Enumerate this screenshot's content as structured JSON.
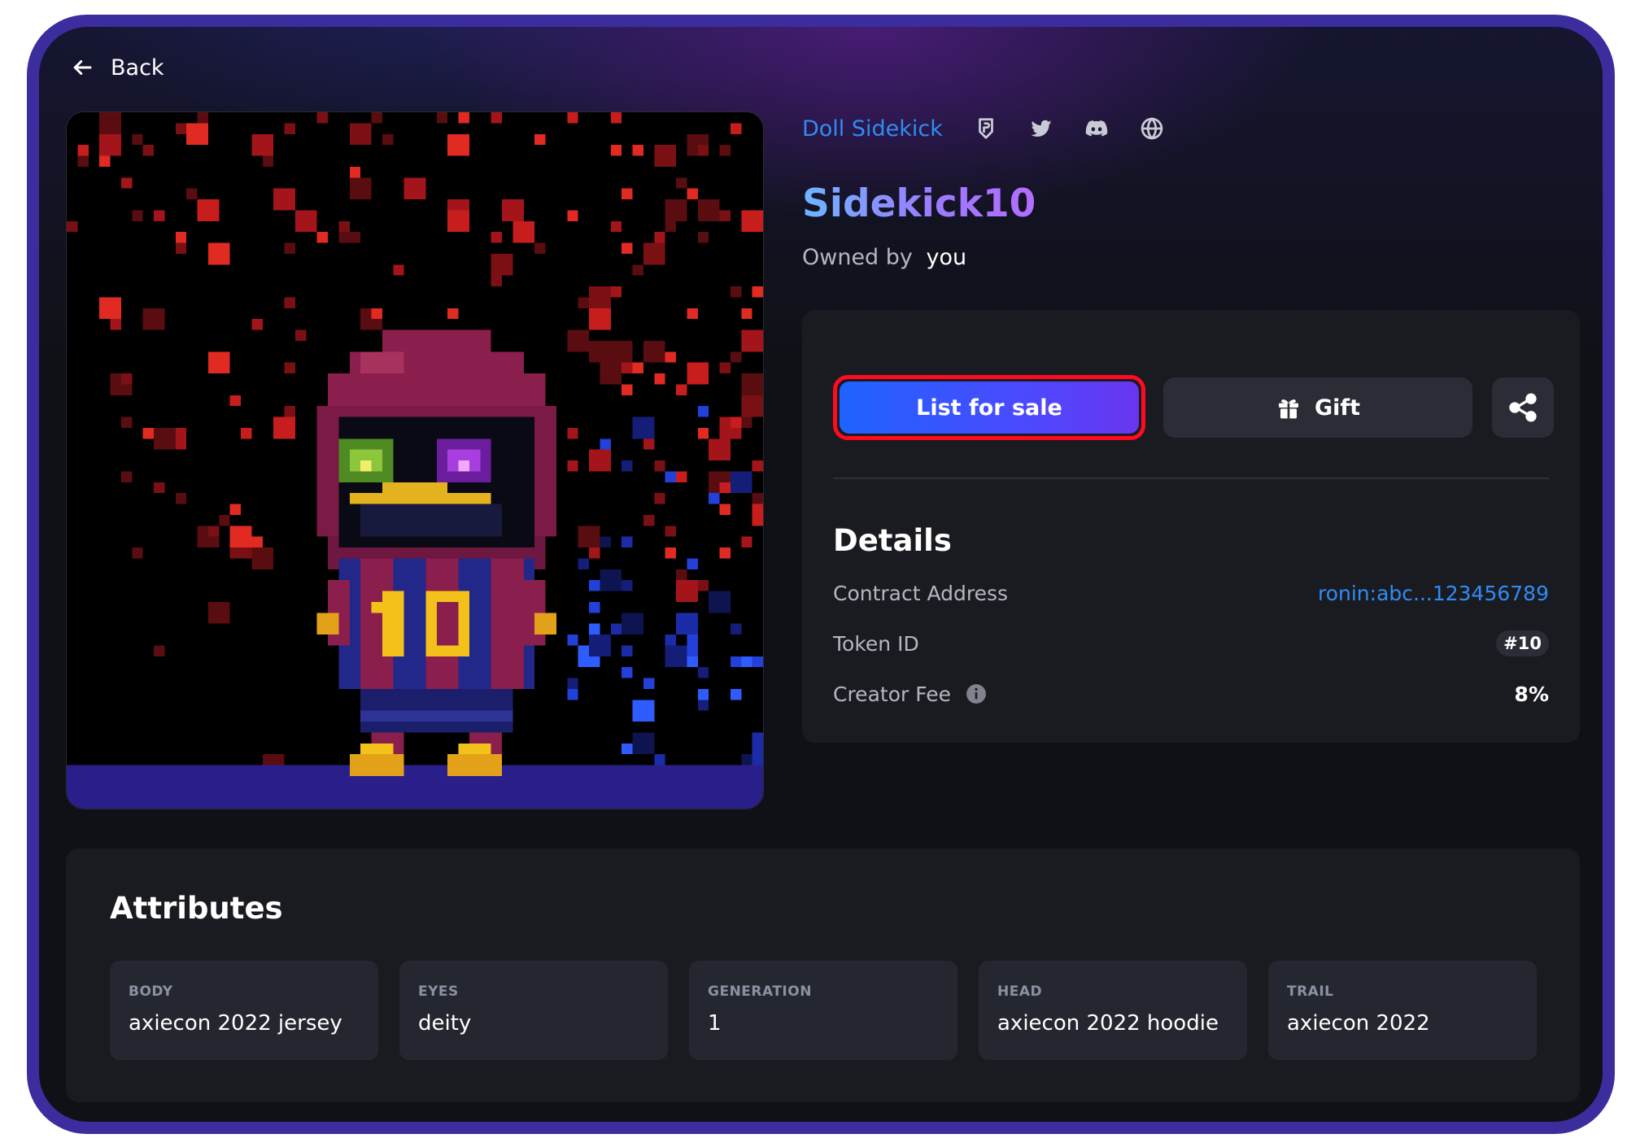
{
  "nav": {
    "back_label": "Back"
  },
  "collection": {
    "name": "Doll Sidekick",
    "social_icons": [
      "ronin-shield-icon",
      "twitter-icon",
      "discord-icon",
      "globe-icon"
    ]
  },
  "nft": {
    "name": "Sidekick10",
    "owned_by_label": "Owned by",
    "owner": "you",
    "jersey_number": "10"
  },
  "actions": {
    "list_for_sale_label": "List for sale",
    "gift_label": "Gift",
    "share_icon": "share-icon"
  },
  "details": {
    "title": "Details",
    "rows": [
      {
        "label": "Contract Address",
        "value": "ronin:abc...123456789"
      },
      {
        "label": "Token ID",
        "value": "#10"
      },
      {
        "label": "Creator Fee",
        "value": "8%"
      }
    ]
  },
  "attributes": {
    "title": "Attributes",
    "items": [
      {
        "label": "BODY",
        "value": "axiecon 2022 jersey"
      },
      {
        "label": "EYES",
        "value": "deity"
      },
      {
        "label": "GENERATION",
        "value": "1"
      },
      {
        "label": "HEAD",
        "value": "axiecon 2022 hoodie"
      },
      {
        "label": "TRAIL",
        "value": "axiecon 2022"
      }
    ]
  },
  "colors": {
    "accent_blue": "#2f8cf5",
    "highlight_red": "#ff0a1e",
    "panel_bg": "#1a1b21",
    "frame": "#3c2d9e"
  }
}
